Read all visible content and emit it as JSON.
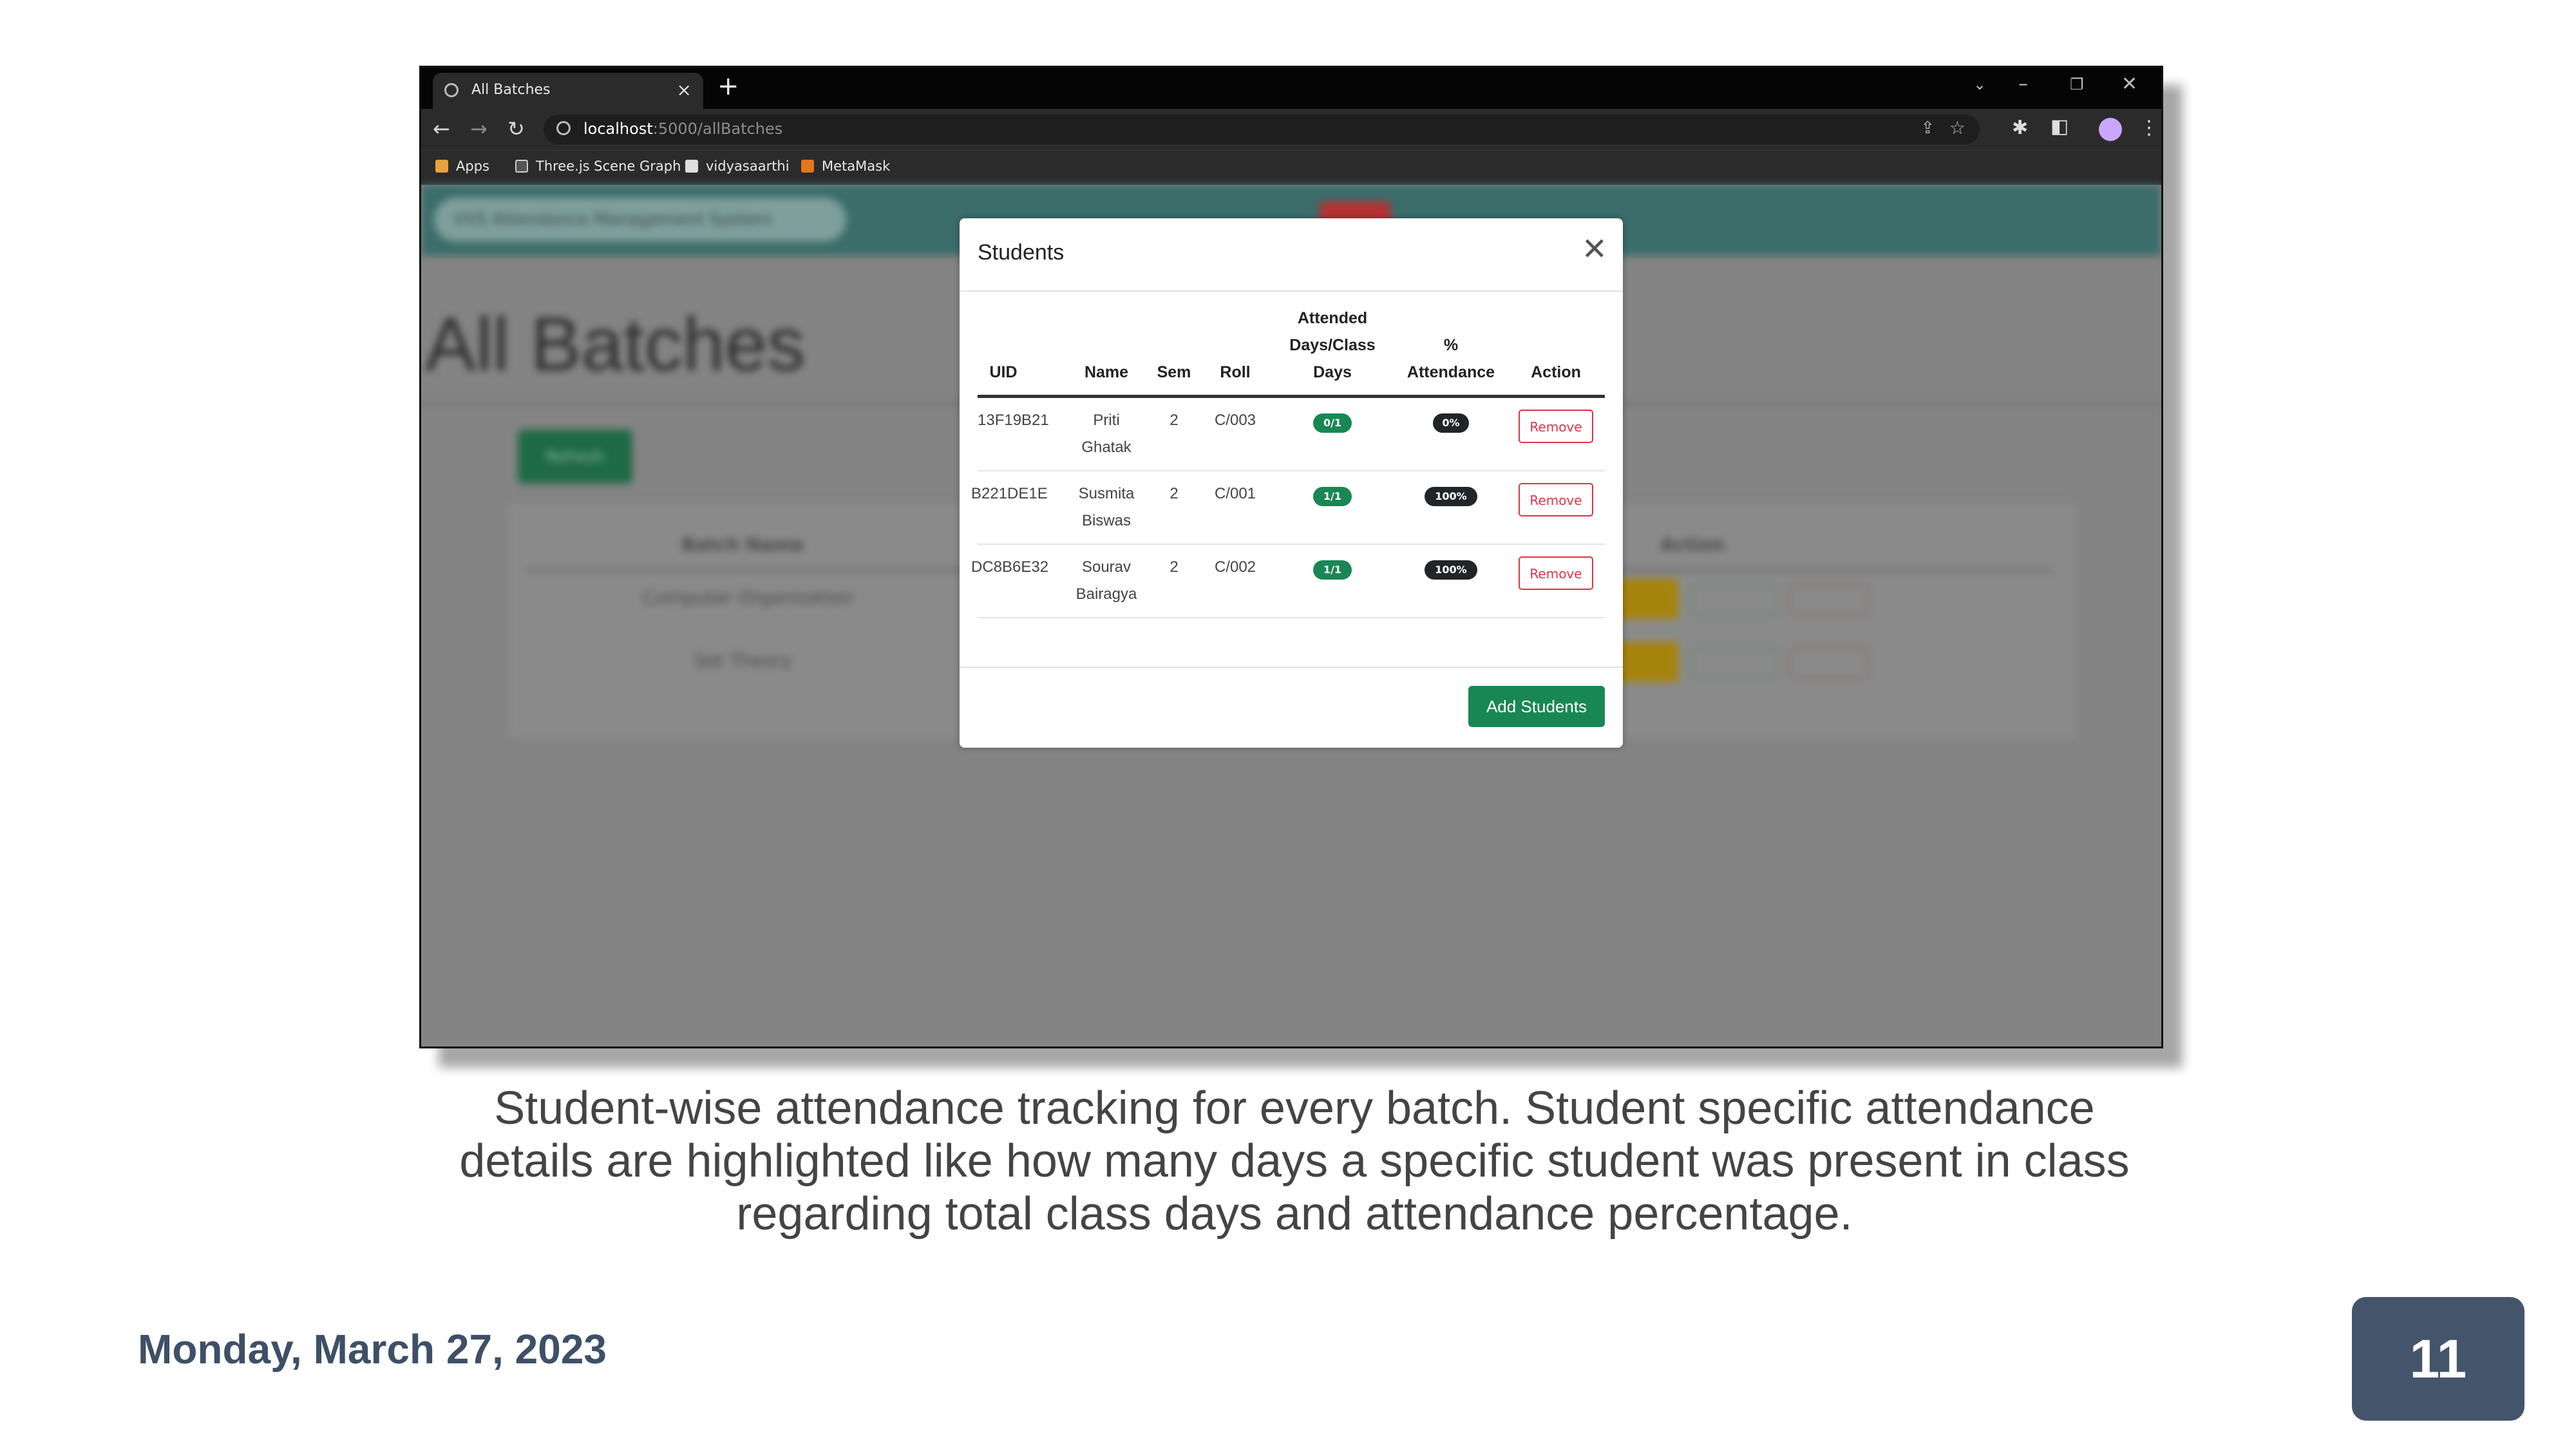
{
  "browser": {
    "tab_title": "All Batches",
    "url_host": "localhost",
    "url_rest": ":5000/allBatches",
    "bookmarks": [
      {
        "label": "Apps",
        "icon": "apps-grid-icon"
      },
      {
        "label": "Three.js Scene Graph",
        "icon": "threejs-icon"
      },
      {
        "label": "vidyasaarthi",
        "icon": "bookmark-page-icon"
      },
      {
        "label": "MetaMask",
        "icon": "metamask-fox-icon"
      }
    ]
  },
  "background_page": {
    "brand": "VVS Attendance Management System",
    "title": "All Batches",
    "refresh_label": "Refresh",
    "table_header_batch": "Batch Name",
    "table_header_action": "Action",
    "rows": [
      "Computer Organization",
      "Set Theory"
    ],
    "action_view": "Activate",
    "action_delete": "Delete"
  },
  "modal": {
    "title": "Students",
    "columns": {
      "uid": "UID",
      "name": "Name",
      "sem": "Sem",
      "roll": "Roll",
      "attended_1": "Attended",
      "attended_2": "Days/Class",
      "attended_3": "Days",
      "percent_1": "%",
      "percent_2": "Attendance",
      "action": "Action"
    },
    "rows": [
      {
        "uid": "13F19B21",
        "name_1": "Priti",
        "name_2": "Ghatak",
        "sem": "2",
        "roll": "C/003",
        "attended": "0/1",
        "percent": "0%",
        "action": "Remove"
      },
      {
        "uid": "B221DE1E",
        "name_1": "Susmita",
        "name_2": "Biswas",
        "sem": "2",
        "roll": "C/001",
        "attended": "1/1",
        "percent": "100%",
        "action": "Remove"
      },
      {
        "uid": "DC8B6E32",
        "name_1": "Sourav",
        "name_2": "Bairagya",
        "sem": "2",
        "roll": "C/002",
        "attended": "1/1",
        "percent": "100%",
        "action": "Remove"
      }
    ],
    "add_button": "Add Students"
  },
  "slide": {
    "caption_1": "Student-wise attendance tracking for every batch. Student specific attendance",
    "caption_2": "details are highlighted like how many days a specific student was present in class",
    "caption_3": "regarding total class days and attendance percentage.",
    "date": "Monday, March 27, 2023",
    "page_number": "11"
  },
  "colors": {
    "accent_green": "#198754",
    "danger_red": "#dc3545",
    "navbar_teal": "#3b6d6a",
    "page_badge": "#44546a"
  }
}
